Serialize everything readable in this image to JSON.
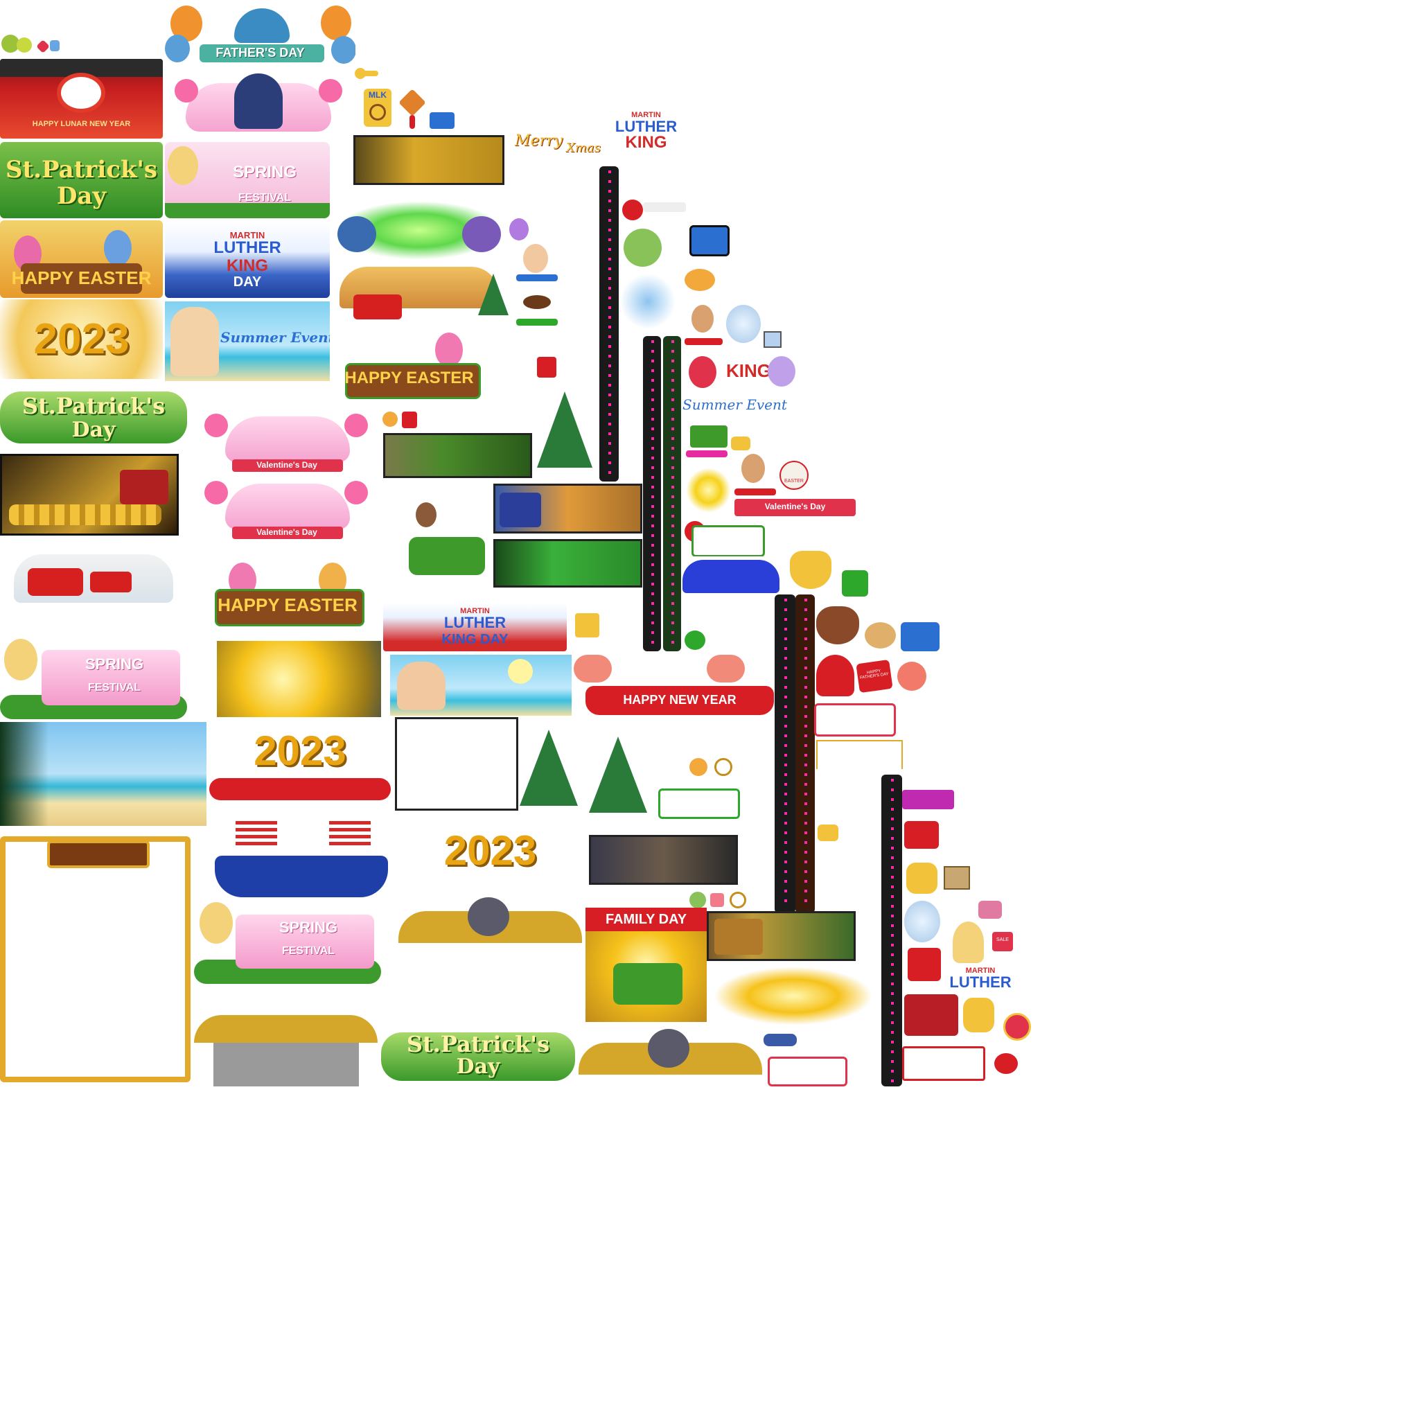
{
  "atlas": {
    "fathers_day": "FATHER'S DAY",
    "lunar_new_year": "HAPPY LUNAR NEW YEAR",
    "st_patricks_1": "St.Patrick's",
    "st_patricks_2": "Day",
    "spring": "SPRING",
    "festival": "FESTIVAL",
    "happy_easter": "HAPPY EASTER",
    "year_2023": "2023",
    "summer_event": "Summer Event",
    "mlk_martin": "MARTIN",
    "mlk_luther": "LUTHER",
    "mlk_king": "KING",
    "mlk_day": "DAY",
    "mlk_king_day": "KING DAY",
    "mlk_badge": "MLK",
    "merry": "Merry",
    "xmas": "Xmas",
    "valentines_day": "Valentine's Day",
    "happy_new_year": "HAPPY NEW YEAR",
    "family_day": "FAMILY DAY",
    "easter_small": "EASTER",
    "happy_fathers_day_small": "HAPPY FATHER'S DAY",
    "sale_tag": "SALE"
  },
  "colors": {
    "gold": "#f5b41a",
    "green": "#2e9e2a",
    "red": "#d81e25",
    "pink": "#f07ab8",
    "blue": "#1f4fb8",
    "dark": "#1a1a1a",
    "magenta": "#ff2aa6"
  },
  "icons": [
    "key-icon",
    "treasure-chest-icon",
    "santa-sleigh-icon",
    "christmas-tree-icon",
    "easter-egg-icon",
    "balloon-icon",
    "car-icon",
    "truck-icon",
    "gift-icon",
    "bell-icon",
    "peace-sign-icon",
    "snow-globe-icon",
    "lion-dance-icon",
    "pot-of-gold-icon",
    "leprechaun-hat-icon",
    "champagne-icon",
    "firework-icon"
  ]
}
